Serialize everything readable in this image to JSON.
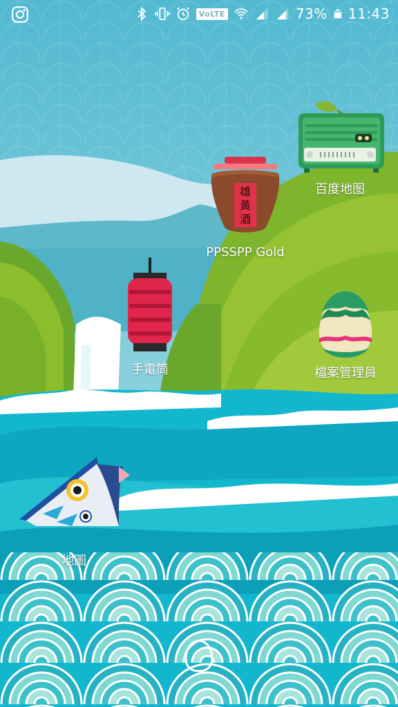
{
  "status_bar": {
    "left_icon": "instagram-icon",
    "icons": [
      "bluetooth-icon",
      "vibrate-icon",
      "alarm-icon",
      "wifi-icon",
      "signal-icon",
      "signal-icon",
      "battery-icon"
    ],
    "volte": "VoLTE",
    "battery_percent": "73%",
    "battery_level": 0.73,
    "time": "11:43"
  },
  "apps": {
    "radio": {
      "label": "百度地图",
      "icon": "radio-icon"
    },
    "jar": {
      "label": "PPSSPP Gold",
      "icon": "wine-jar-icon",
      "jar_text": [
        "雄",
        "黃",
        "酒"
      ]
    },
    "lantern": {
      "label": "手電筒",
      "icon": "lantern-icon"
    },
    "egg": {
      "label": "檔案管理員",
      "icon": "egg-icon"
    },
    "fish": {
      "label": "地圖",
      "icon": "koinobori-fish-icon"
    }
  },
  "navigation": {
    "home_icon": "home-button-icon"
  },
  "colors": {
    "sky": "#5fc3d9",
    "hill_green": "#8bbd2c",
    "sea": "#1bb6c9",
    "foam": "#ffffff",
    "wave_pattern": "#7fd8d2"
  }
}
